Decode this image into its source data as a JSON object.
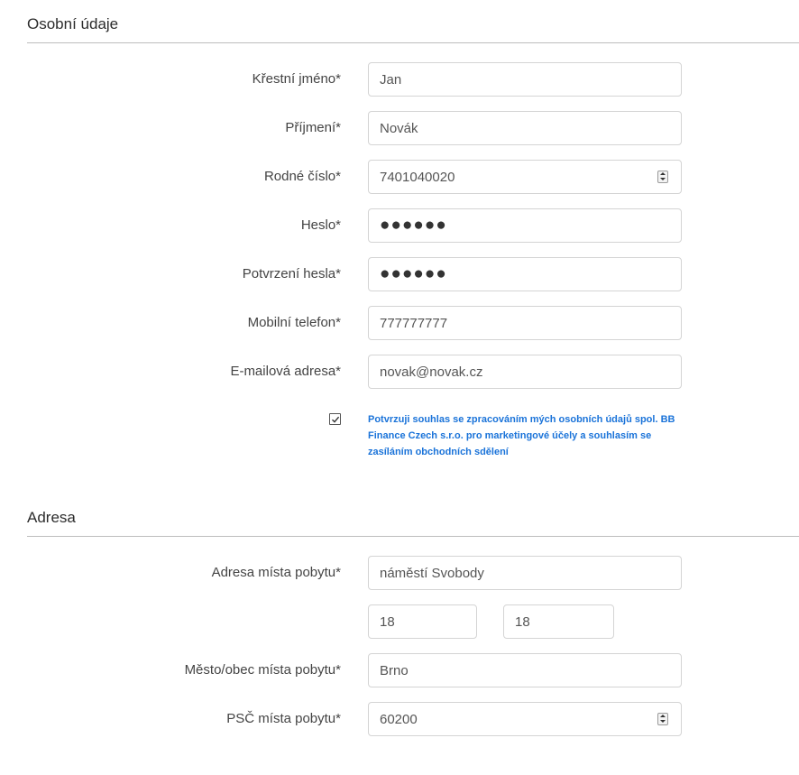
{
  "personal": {
    "title": "Osobní údaje",
    "first_name_label": "Křestní jméno*",
    "first_name_value": "Jan",
    "last_name_label": "Příjmení*",
    "last_name_value": "Novák",
    "birth_number_label": "Rodné číslo*",
    "birth_number_value": "7401040020",
    "password_label": "Heslo*",
    "password_value": "●●●●●●",
    "password_confirm_label": "Potvrzení hesla*",
    "password_confirm_value": "●●●●●●",
    "mobile_label": "Mobilní telefon*",
    "mobile_value": "777777777",
    "email_label": "E-mailová adresa*",
    "email_value": "novak@novak.cz",
    "consent_checked": true,
    "consent_text": "Potvrzuji souhlas se zpracováním mých osobních údajů spol. BB Finance Czech s.r.o. pro marketingové účely a souhlasím se zasíláním obchodních sdělení",
    "consent_color": "#1a73d9"
  },
  "address": {
    "title": "Adresa",
    "street_label": "Adresa místa pobytu*",
    "street_value": "náměstí Svobody",
    "house_number_value": "18",
    "orientation_number_value": "18",
    "city_label": "Město/obec místa pobytu*",
    "city_value": "Brno",
    "zip_label": "PSČ místa pobytu*",
    "zip_value": "60200"
  }
}
